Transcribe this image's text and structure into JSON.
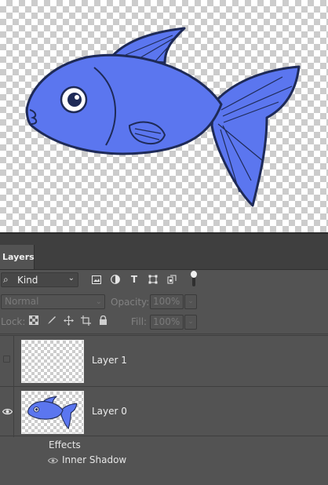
{
  "panel": {
    "tab_label": "Layers"
  },
  "filter": {
    "kind_label": "Kind",
    "icons": [
      "image-filter-icon",
      "adjustment-filter-icon",
      "type-filter-icon",
      "shape-filter-icon",
      "smart-object-filter-icon"
    ],
    "type_glyph": "T"
  },
  "blend": {
    "mode": "Normal",
    "opacity_label": "Opacity:",
    "opacity_value": "100%"
  },
  "lock": {
    "label": "Lock:",
    "fill_label": "Fill:",
    "fill_value": "100%"
  },
  "layers": [
    {
      "name": "Layer 1",
      "visible": false
    },
    {
      "name": "Layer 0",
      "visible": true,
      "effects_label": "Effects",
      "effects": [
        "Inner Shadow"
      ]
    }
  ],
  "colors": {
    "fish_fill": "#5b76ef",
    "fish_outline": "#1e2a57",
    "panel_bg": "#535353"
  }
}
